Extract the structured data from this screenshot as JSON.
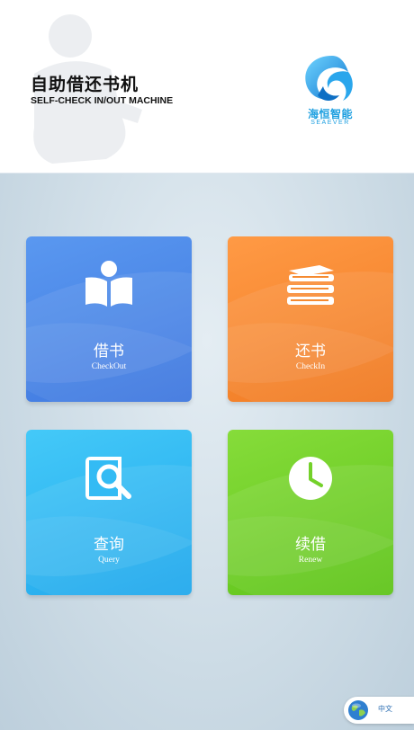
{
  "header": {
    "title_cn": "自助借还书机",
    "title_en": "SELF-CHECK IN/OUT MACHINE",
    "logo_text_cn": "海恒智能",
    "logo_text_en": "SEAEVER"
  },
  "tiles": [
    {
      "label_cn": "借书",
      "label_en": "CheckOut",
      "icon": "open-book-icon",
      "color": "#4a89ea"
    },
    {
      "label_cn": "还书",
      "label_en": "CheckIn",
      "icon": "book-stack-icon",
      "color": "#f58a30"
    },
    {
      "label_cn": "查询",
      "label_en": "Query",
      "icon": "book-search-icon",
      "color": "#33bbf4"
    },
    {
      "label_cn": "续借",
      "label_en": "Renew",
      "icon": "clock-icon",
      "color": "#74d12a"
    }
  ],
  "language": {
    "label": "中文",
    "icon": "globe-icon"
  }
}
